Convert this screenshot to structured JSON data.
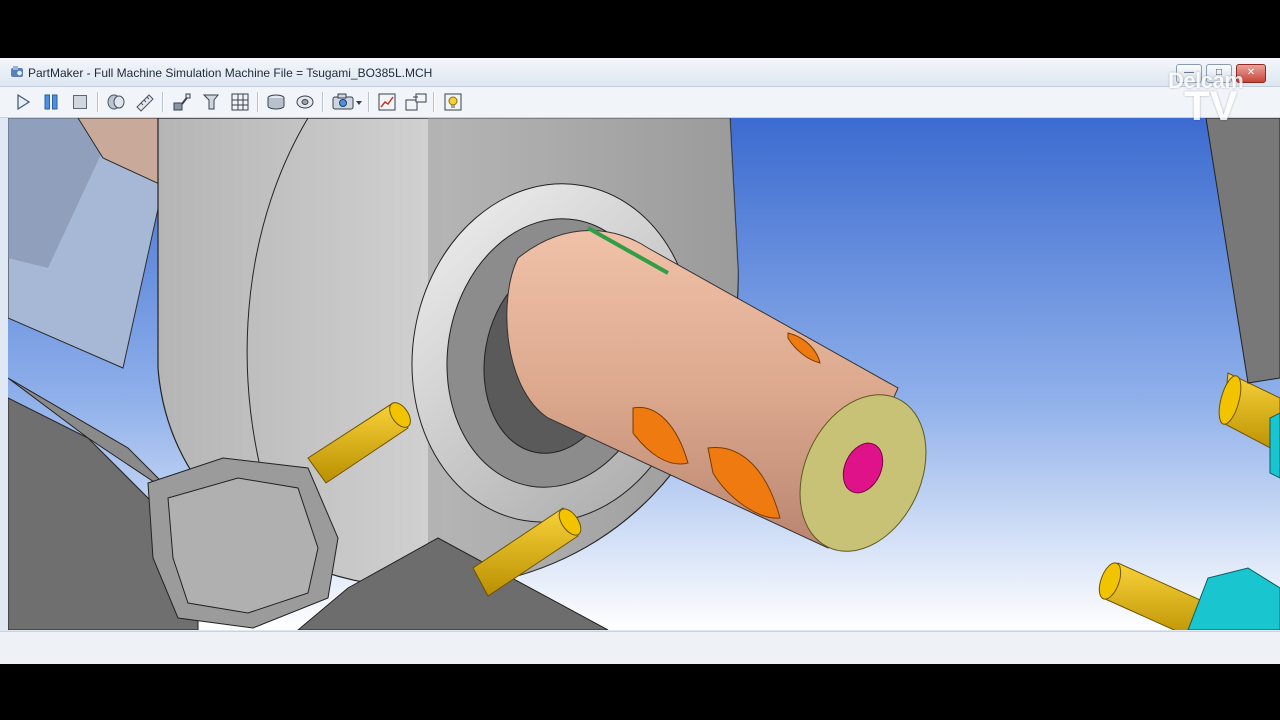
{
  "window": {
    "app_name": "PartMaker",
    "title": "PartMaker - Full Machine Simulation   Machine File = Tsugami_BO385L.MCH"
  },
  "window_controls": [
    "minimize",
    "maximize",
    "close"
  ],
  "toolbar": {
    "buttons": [
      {
        "name": "play",
        "icon": "play-icon"
      },
      {
        "name": "pause",
        "icon": "pause-icon"
      },
      {
        "name": "stop",
        "icon": "stop-icon"
      },
      {
        "name": "part-view",
        "icon": "part-icon"
      },
      {
        "name": "measure",
        "icon": "ruler-icon"
      },
      {
        "name": "tool-path",
        "icon": "tool-path-icon"
      },
      {
        "name": "tool",
        "icon": "tool-icon"
      },
      {
        "name": "grid",
        "icon": "grid-icon"
      },
      {
        "name": "stock",
        "icon": "stock-icon"
      },
      {
        "name": "rotate",
        "icon": "rotate-icon"
      },
      {
        "name": "camera",
        "icon": "camera-icon"
      },
      {
        "name": "chart",
        "icon": "chart-icon"
      },
      {
        "name": "windows",
        "icon": "windows-icon"
      },
      {
        "name": "highlight",
        "icon": "highlight-icon"
      }
    ]
  },
  "overlay": {
    "brand_top": "Delcam",
    "brand_bottom": "TV"
  },
  "status": {
    "text": ""
  },
  "colors": {
    "workpiece": "#dca98e",
    "face": "#c8c277",
    "pocket": "#ef7a10",
    "bore": "#e0128a",
    "pin": "#e7b800",
    "chuck": "#c9c9c9",
    "sky_top": "#3f6fd2",
    "sky_bottom": "#ffffff",
    "cyan_part": "#19c6cf"
  }
}
